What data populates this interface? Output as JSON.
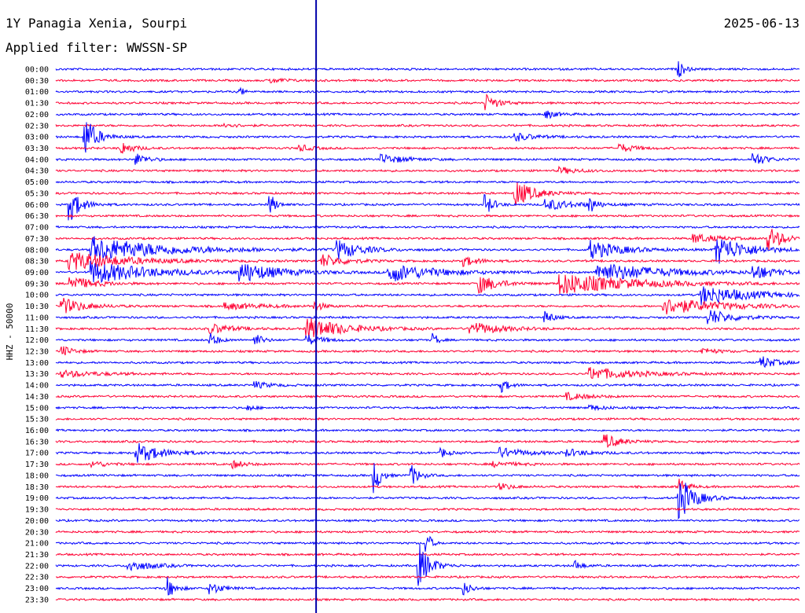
{
  "header": {
    "station": "1Y Panagia Xenia, Sourpi",
    "date": "2025-06-13",
    "filter": "Applied filter: WWSSN-SP"
  },
  "chart_data": {
    "type": "line",
    "title": "1Y Panagia Xenia, Sourpi",
    "ylabel": "HHZ - 50000",
    "colors": {
      "blue": "#0000ff",
      "red": "#ff0033",
      "marker": "#0000aa"
    },
    "row_labels": [
      "00:00",
      "00:30",
      "01:00",
      "01:30",
      "02:00",
      "02:30",
      "03:00",
      "03:30",
      "04:00",
      "04:30",
      "05:00",
      "05:30",
      "06:00",
      "06:30",
      "07:00",
      "07:30",
      "08:00",
      "08:30",
      "09:00",
      "09:30",
      "10:00",
      "10:30",
      "11:00",
      "11:30",
      "12:00",
      "12:30",
      "13:00",
      "13:30",
      "14:00",
      "14:30",
      "15:00",
      "15:30",
      "16:00",
      "16:30",
      "17:00",
      "17:30",
      "18:00",
      "18:30",
      "19:00",
      "19:30",
      "20:00",
      "20:30",
      "21:00",
      "21:30",
      "22:00",
      "22:30",
      "23:00",
      "23:30"
    ],
    "minutes_per_row": 30,
    "current_time_fraction": 0.35,
    "events": [
      {
        "row": 0,
        "x": 0.84,
        "amp": 9,
        "dur": 0.015
      },
      {
        "row": 1,
        "x": 0.29,
        "amp": 3,
        "dur": 0.04
      },
      {
        "row": 2,
        "x": 0.25,
        "amp": 4,
        "dur": 0.01
      },
      {
        "row": 3,
        "x": 0.58,
        "amp": 10,
        "dur": 0.03
      },
      {
        "row": 4,
        "x": 0.66,
        "amp": 5,
        "dur": 0.03
      },
      {
        "row": 5,
        "x": 0.23,
        "amp": 3,
        "dur": 0.03
      },
      {
        "row": 6,
        "x": 0.04,
        "amp": 26,
        "dur": 0.03
      },
      {
        "row": 6,
        "x": 0.62,
        "amp": 5,
        "dur": 0.05
      },
      {
        "row": 7,
        "x": 0.09,
        "amp": 8,
        "dur": 0.03
      },
      {
        "row": 7,
        "x": 0.33,
        "amp": 4,
        "dur": 0.03
      },
      {
        "row": 7,
        "x": 0.76,
        "amp": 5,
        "dur": 0.04
      },
      {
        "row": 8,
        "x": 0.11,
        "amp": 7,
        "dur": 0.03
      },
      {
        "row": 8,
        "x": 0.44,
        "amp": 6,
        "dur": 0.06
      },
      {
        "row": 8,
        "x": 0.94,
        "amp": 9,
        "dur": 0.03
      },
      {
        "row": 9,
        "x": 0.68,
        "amp": 4,
        "dur": 0.05
      },
      {
        "row": 11,
        "x": 0.62,
        "amp": 16,
        "dur": 0.05
      },
      {
        "row": 12,
        "x": 0.02,
        "amp": 20,
        "dur": 0.03
      },
      {
        "row": 12,
        "x": 0.29,
        "amp": 12,
        "dur": 0.015
      },
      {
        "row": 12,
        "x": 0.58,
        "amp": 12,
        "dur": 0.02
      },
      {
        "row": 12,
        "x": 0.66,
        "amp": 7,
        "dur": 0.08
      },
      {
        "row": 12,
        "x": 0.72,
        "amp": 9,
        "dur": 0.015
      },
      {
        "row": 15,
        "x": 0.86,
        "amp": 6,
        "dur": 0.06
      },
      {
        "row": 15,
        "x": 0.96,
        "amp": 14,
        "dur": 0.04
      },
      {
        "row": 16,
        "x": 0.05,
        "amp": 16,
        "dur": 0.2
      },
      {
        "row": 16,
        "x": 0.38,
        "amp": 12,
        "dur": 0.06
      },
      {
        "row": 16,
        "x": 0.72,
        "amp": 12,
        "dur": 0.08
      },
      {
        "row": 16,
        "x": 0.89,
        "amp": 18,
        "dur": 0.08
      },
      {
        "row": 17,
        "x": 0.02,
        "amp": 12,
        "dur": 0.15
      },
      {
        "row": 17,
        "x": 0.36,
        "amp": 8,
        "dur": 0.06
      },
      {
        "row": 17,
        "x": 0.55,
        "amp": 6,
        "dur": 0.04
      },
      {
        "row": 18,
        "x": 0.05,
        "amp": 14,
        "dur": 0.16
      },
      {
        "row": 18,
        "x": 0.25,
        "amp": 12,
        "dur": 0.1
      },
      {
        "row": 18,
        "x": 0.45,
        "amp": 12,
        "dur": 0.12
      },
      {
        "row": 18,
        "x": 0.73,
        "amp": 12,
        "dur": 0.18
      },
      {
        "row": 18,
        "x": 0.94,
        "amp": 9,
        "dur": 0.05
      },
      {
        "row": 19,
        "x": 0.02,
        "amp": 10,
        "dur": 0.06
      },
      {
        "row": 19,
        "x": 0.57,
        "amp": 12,
        "dur": 0.05
      },
      {
        "row": 19,
        "x": 0.68,
        "amp": 14,
        "dur": 0.19
      },
      {
        "row": 20,
        "x": 0.87,
        "amp": 12,
        "dur": 0.13
      },
      {
        "row": 21,
        "x": 0.01,
        "amp": 10,
        "dur": 0.06
      },
      {
        "row": 21,
        "x": 0.23,
        "amp": 4,
        "dur": 0.1
      },
      {
        "row": 21,
        "x": 0.35,
        "amp": 6,
        "dur": 0.02
      },
      {
        "row": 21,
        "x": 0.82,
        "amp": 10,
        "dur": 0.16
      },
      {
        "row": 22,
        "x": 0.66,
        "amp": 8,
        "dur": 0.02
      },
      {
        "row": 22,
        "x": 0.88,
        "amp": 10,
        "dur": 0.06
      },
      {
        "row": 23,
        "x": 0.21,
        "amp": 6,
        "dur": 0.06
      },
      {
        "row": 23,
        "x": 0.34,
        "amp": 14,
        "dur": 0.1
      },
      {
        "row": 23,
        "x": 0.56,
        "amp": 8,
        "dur": 0.08
      },
      {
        "row": 24,
        "x": 0.21,
        "amp": 8,
        "dur": 0.02
      },
      {
        "row": 24,
        "x": 0.27,
        "amp": 7,
        "dur": 0.02
      },
      {
        "row": 24,
        "x": 0.34,
        "amp": 6,
        "dur": 0.04
      },
      {
        "row": 24,
        "x": 0.51,
        "amp": 8,
        "dur": 0.01
      },
      {
        "row": 25,
        "x": 0.01,
        "amp": 6,
        "dur": 0.03
      },
      {
        "row": 25,
        "x": 0.87,
        "amp": 4,
        "dur": 0.04
      },
      {
        "row": 26,
        "x": 0.95,
        "amp": 8,
        "dur": 0.04
      },
      {
        "row": 27,
        "x": 0.01,
        "amp": 4,
        "dur": 0.1
      },
      {
        "row": 27,
        "x": 0.72,
        "amp": 8,
        "dur": 0.12
      },
      {
        "row": 28,
        "x": 0.27,
        "amp": 4,
        "dur": 0.04
      },
      {
        "row": 28,
        "x": 0.6,
        "amp": 8,
        "dur": 0.02
      },
      {
        "row": 29,
        "x": 0.69,
        "amp": 4,
        "dur": 0.06
      },
      {
        "row": 30,
        "x": 0.26,
        "amp": 3,
        "dur": 0.02
      },
      {
        "row": 30,
        "x": 0.72,
        "amp": 3,
        "dur": 0.04
      },
      {
        "row": 33,
        "x": 0.74,
        "amp": 9,
        "dur": 0.04
      },
      {
        "row": 34,
        "x": 0.11,
        "amp": 12,
        "dur": 0.07
      },
      {
        "row": 34,
        "x": 0.52,
        "amp": 5,
        "dur": 0.02
      },
      {
        "row": 34,
        "x": 0.6,
        "amp": 6,
        "dur": 0.07
      },
      {
        "row": 34,
        "x": 0.69,
        "amp": 4,
        "dur": 0.06
      },
      {
        "row": 35,
        "x": 0.05,
        "amp": 4,
        "dur": 0.04
      },
      {
        "row": 35,
        "x": 0.24,
        "amp": 5,
        "dur": 0.03
      },
      {
        "row": 35,
        "x": 0.59,
        "amp": 3,
        "dur": 0.06
      },
      {
        "row": 36,
        "x": 0.43,
        "amp": 22,
        "dur": 0.015
      },
      {
        "row": 36,
        "x": 0.48,
        "amp": 12,
        "dur": 0.02
      },
      {
        "row": 37,
        "x": 0.6,
        "amp": 4,
        "dur": 0.03
      },
      {
        "row": 37,
        "x": 0.84,
        "amp": 10,
        "dur": 0.02
      },
      {
        "row": 38,
        "x": 0.84,
        "amp": 26,
        "dur": 0.04
      },
      {
        "row": 42,
        "x": 0.5,
        "amp": 16,
        "dur": 0.01
      },
      {
        "row": 44,
        "x": 0.1,
        "amp": 7,
        "dur": 0.06
      },
      {
        "row": 44,
        "x": 0.49,
        "amp": 26,
        "dur": 0.03
      },
      {
        "row": 44,
        "x": 0.7,
        "amp": 6,
        "dur": 0.02
      },
      {
        "row": 46,
        "x": 0.15,
        "amp": 14,
        "dur": 0.02
      },
      {
        "row": 46,
        "x": 0.21,
        "amp": 7,
        "dur": 0.03
      },
      {
        "row": 46,
        "x": 0.55,
        "amp": 8,
        "dur": 0.02
      }
    ]
  }
}
